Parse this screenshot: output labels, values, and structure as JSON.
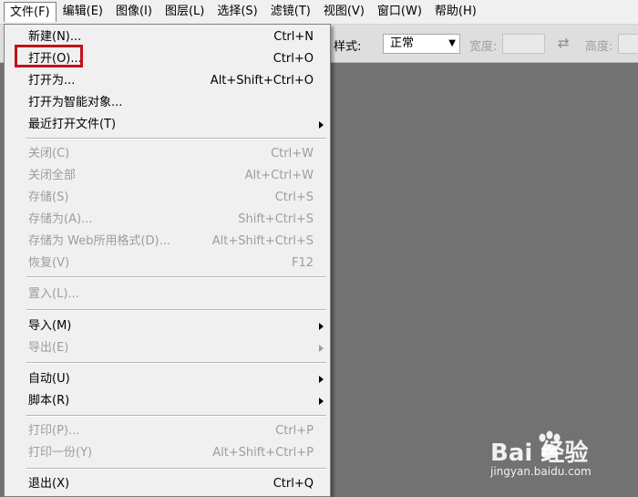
{
  "menubar": {
    "items": [
      "文件(F)",
      "编辑(E)",
      "图像(I)",
      "图层(L)",
      "选择(S)",
      "滤镜(T)",
      "视图(V)",
      "窗口(W)",
      "帮助(H)"
    ],
    "active_index": 0
  },
  "options": {
    "style_label": "样式:",
    "style_value": "正常",
    "width_label": "宽度:",
    "height_label": "高度:"
  },
  "file_menu": {
    "items": [
      {
        "label": "新建(N)...",
        "shortcut": "Ctrl+N",
        "enabled": true,
        "submenu": false
      },
      {
        "label": "打开(O)...",
        "shortcut": "Ctrl+O",
        "enabled": true,
        "submenu": false,
        "highlighted": true
      },
      {
        "label": "打开为...",
        "shortcut": "Alt+Shift+Ctrl+O",
        "enabled": true,
        "submenu": false
      },
      {
        "label": "打开为智能对象...",
        "shortcut": "",
        "enabled": true,
        "submenu": false
      },
      {
        "label": "最近打开文件(T)",
        "shortcut": "",
        "enabled": true,
        "submenu": true
      },
      {
        "label": "关闭(C)",
        "shortcut": "Ctrl+W",
        "enabled": false,
        "submenu": false
      },
      {
        "label": "关闭全部",
        "shortcut": "Alt+Ctrl+W",
        "enabled": false,
        "submenu": false
      },
      {
        "label": "存储(S)",
        "shortcut": "Ctrl+S",
        "enabled": false,
        "submenu": false
      },
      {
        "label": "存储为(A)...",
        "shortcut": "Shift+Ctrl+S",
        "enabled": false,
        "submenu": false
      },
      {
        "label": "存储为 Web所用格式(D)...",
        "shortcut": "Alt+Shift+Ctrl+S",
        "enabled": false,
        "submenu": false
      },
      {
        "label": "恢复(V)",
        "shortcut": "F12",
        "enabled": false,
        "submenu": false
      },
      {
        "label": "置入(L)...",
        "shortcut": "",
        "enabled": false,
        "submenu": false
      },
      {
        "label": "导入(M)",
        "shortcut": "",
        "enabled": true,
        "submenu": true
      },
      {
        "label": "导出(E)",
        "shortcut": "",
        "enabled": false,
        "submenu": true
      },
      {
        "label": "自动(U)",
        "shortcut": "",
        "enabled": true,
        "submenu": true
      },
      {
        "label": "脚本(R)",
        "shortcut": "",
        "enabled": true,
        "submenu": true
      },
      {
        "label": "打印(P)...",
        "shortcut": "Ctrl+P",
        "enabled": false,
        "submenu": false
      },
      {
        "label": "打印一份(Y)",
        "shortcut": "Alt+Shift+Ctrl+P",
        "enabled": false,
        "submenu": false
      },
      {
        "label": "退出(X)",
        "shortcut": "Ctrl+Q",
        "enabled": true,
        "submenu": false
      }
    ]
  },
  "watermark": {
    "logo_text": "Bai  经验",
    "url": "jingyan.baidu.com"
  },
  "colors": {
    "canvas": "#727272",
    "highlight_border": "#c1121a",
    "disabled_text": "#9d9d9d"
  }
}
